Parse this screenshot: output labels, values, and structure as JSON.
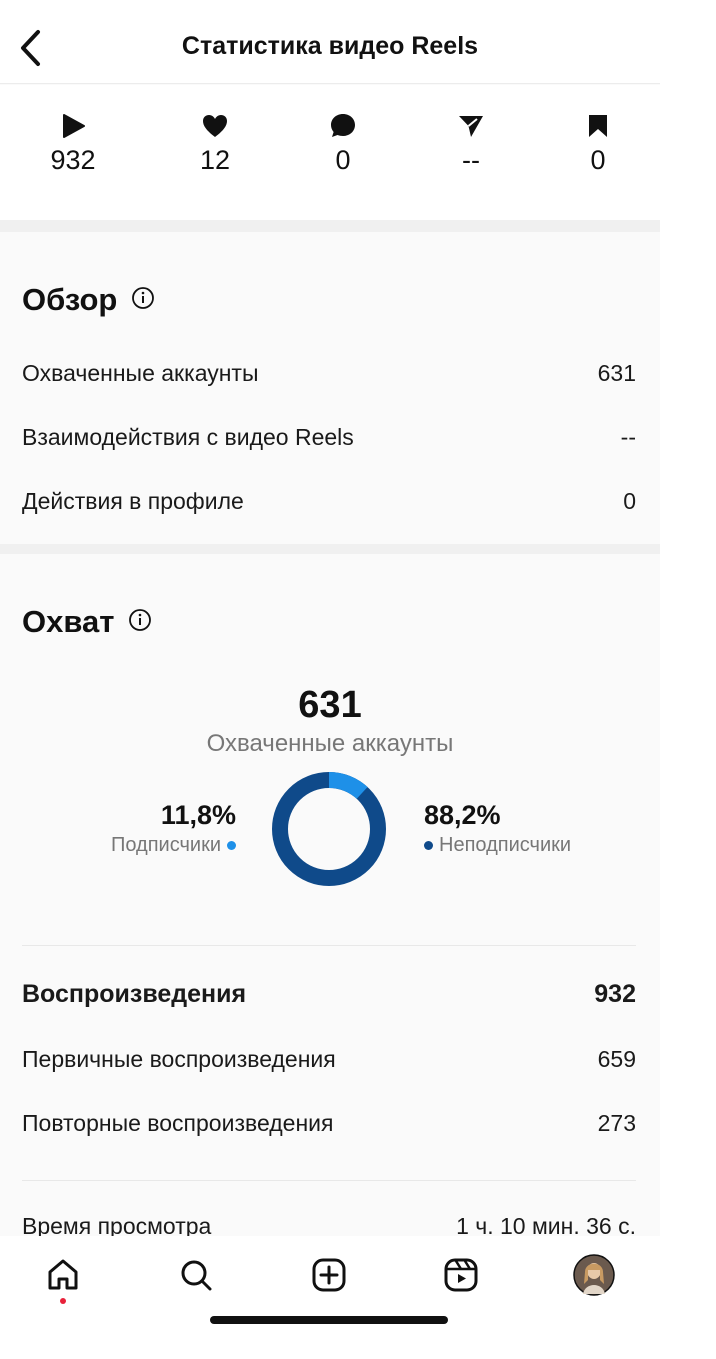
{
  "header": {
    "title": "Статистика видео Reels",
    "back_icon": "chevron-left-icon"
  },
  "metrics": [
    {
      "icon": "play-icon",
      "value": "932"
    },
    {
      "icon": "heart-icon",
      "value": "12"
    },
    {
      "icon": "comment-icon",
      "value": "0"
    },
    {
      "icon": "share-icon",
      "value": "--"
    },
    {
      "icon": "bookmark-icon",
      "value": "0"
    }
  ],
  "overview": {
    "title": "Обзор",
    "rows": [
      {
        "label": "Охваченные аккаунты",
        "value": "631"
      },
      {
        "label": "Взаимодействия с видео Reels",
        "value": "--"
      },
      {
        "label": "Действия в профиле",
        "value": "0"
      }
    ]
  },
  "reach": {
    "title": "Охват",
    "total": "631",
    "total_label": "Охваченные аккаунты",
    "followers": {
      "percent": "11,8%",
      "label": "Подписчики",
      "fraction": 0.118,
      "color": "#1e90e8"
    },
    "non_followers": {
      "percent": "88,2%",
      "label": "Неподписчики",
      "fraction": 0.882,
      "color": "#0f4a8a"
    }
  },
  "plays": {
    "title": "Воспроизведения",
    "total": "932",
    "rows": [
      {
        "label": "Первичные воспроизведения",
        "value": "659"
      },
      {
        "label": "Повторные воспроизведения",
        "value": "273"
      }
    ]
  },
  "watch_time": {
    "label": "Время просмотра",
    "value": "1 ч. 10 мин. 36 с."
  },
  "nav": [
    "home-icon",
    "search-icon",
    "create-icon",
    "reels-icon",
    "profile-avatar"
  ]
}
